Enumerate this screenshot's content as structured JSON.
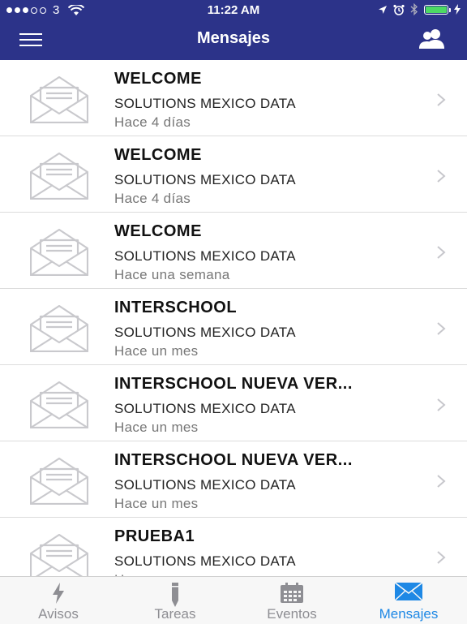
{
  "status": {
    "carrier": "3",
    "time": "11:22 AM"
  },
  "header": {
    "title": "Mensajes"
  },
  "messages": [
    {
      "title": "WELCOME",
      "sender": "SOLUTIONS MEXICO DATA",
      "time": "Hace 4 días"
    },
    {
      "title": "WELCOME",
      "sender": "SOLUTIONS MEXICO DATA",
      "time": "Hace 4 días"
    },
    {
      "title": "WELCOME",
      "sender": "SOLUTIONS MEXICO DATA",
      "time": "Hace una semana"
    },
    {
      "title": "INTERSCHOOL",
      "sender": "SOLUTIONS MEXICO DATA",
      "time": "Hace un mes"
    },
    {
      "title": "INTERSCHOOL NUEVA VER...",
      "sender": "SOLUTIONS MEXICO DATA",
      "time": "Hace un mes"
    },
    {
      "title": "INTERSCHOOL NUEVA VER...",
      "sender": "SOLUTIONS MEXICO DATA",
      "time": "Hace un mes"
    },
    {
      "title": "PRUEBA1",
      "sender": "SOLUTIONS MEXICO DATA",
      "time": "Ha..."
    }
  ],
  "tabs": [
    {
      "label": "Avisos",
      "icon": "lightning-icon",
      "active": false
    },
    {
      "label": "Tareas",
      "icon": "pencil-icon",
      "active": false
    },
    {
      "label": "Eventos",
      "icon": "calendar-icon",
      "active": false
    },
    {
      "label": "Mensajes",
      "icon": "envelope-icon",
      "active": true
    }
  ],
  "colors": {
    "header_bg": "#2c3389",
    "tab_active": "#1e88e5",
    "tab_inactive": "#8e8e93",
    "battery": "#4cd964"
  }
}
